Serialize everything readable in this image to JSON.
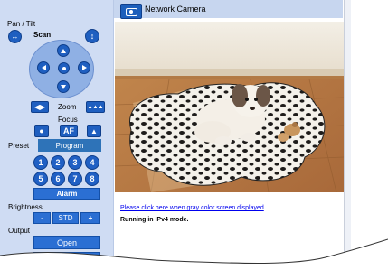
{
  "header": {
    "title": "Network Camera",
    "camera_icon": "camera-icon"
  },
  "pan_tilt": {
    "label": "Pan / Tilt",
    "scan_label": "Scan"
  },
  "zoom": {
    "label": "Zoom"
  },
  "focus": {
    "label": "Focus",
    "af_label": "AF"
  },
  "preset": {
    "tab_preset": "Preset",
    "tab_program": "Program",
    "numbers": [
      "1",
      "2",
      "3",
      "4",
      "5",
      "6",
      "7",
      "8"
    ]
  },
  "alarm": {
    "label": "Alarm"
  },
  "brightness": {
    "label": "Brightness",
    "minus": "-",
    "std": "STD",
    "plus": "+"
  },
  "output": {
    "label": "Output",
    "open": "Open"
  },
  "main": {
    "link_text": "Please click here when gray color screen displayed",
    "status_text": "Running in IPv4 mode."
  },
  "colors": {
    "panel_bg": "#cfdcf3",
    "button_blue": "#1f5fc0",
    "accent": "#2b6fd3",
    "link": "#0000ee"
  }
}
